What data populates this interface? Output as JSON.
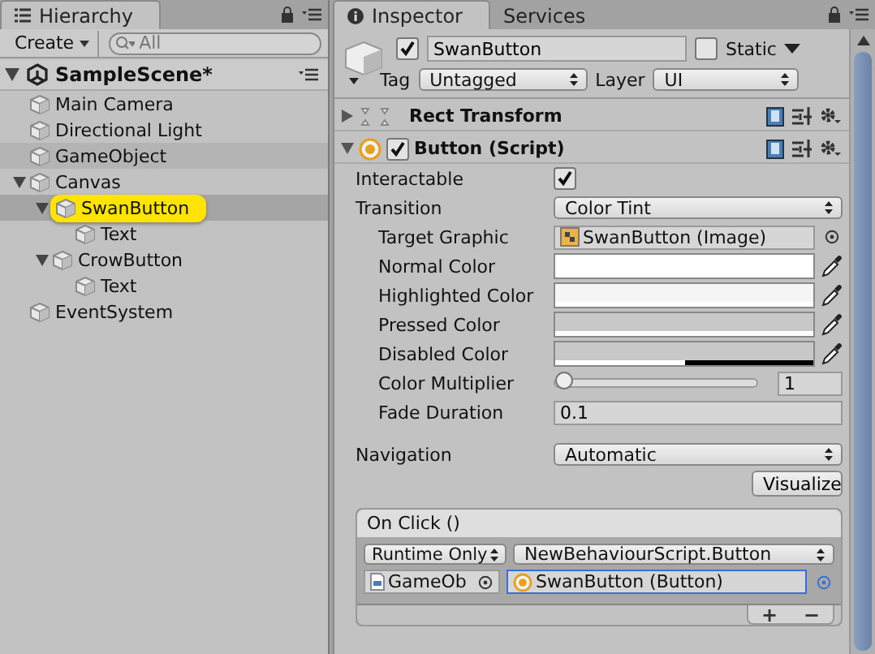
{
  "hierarchy": {
    "tab": "Hierarchy",
    "create": "Create",
    "search": {
      "placeholder": "All"
    },
    "scene": {
      "name": "SampleScene*",
      "expanded": true,
      "children": [
        {
          "name": "Main Camera",
          "selected": false,
          "hovered": false
        },
        {
          "name": "Directional Light",
          "selected": false,
          "hovered": false
        },
        {
          "name": "GameObject",
          "selected": false,
          "hovered": true
        },
        {
          "name": "Canvas",
          "selected": false,
          "hovered": false,
          "expanded": true,
          "children": [
            {
              "name": "SwanButton",
              "selected": true,
              "hovered": false,
              "expanded": true,
              "children": [
                {
                  "name": "Text",
                  "selected": false,
                  "hovered": false
                }
              ]
            },
            {
              "name": "CrowButton",
              "selected": false,
              "hovered": false,
              "expanded": true,
              "children": [
                {
                  "name": "Text",
                  "selected": false,
                  "hovered": false
                }
              ]
            }
          ]
        },
        {
          "name": "EventSystem",
          "selected": false,
          "hovered": false
        }
      ]
    }
  },
  "inspector": {
    "tabs": [
      {
        "label": "Inspector",
        "selected": true
      },
      {
        "label": "Services",
        "selected": false
      }
    ],
    "object": {
      "active": true,
      "name": "SwanButton",
      "static": false,
      "static_label": "Static",
      "tag_label": "Tag",
      "tag": "Untagged",
      "layer_label": "Layer",
      "layer": "UI"
    },
    "components": [
      {
        "kind": "rect",
        "title": "Rect Transform",
        "expanded": false
      },
      {
        "kind": "script",
        "title": "Button (Script)",
        "expanded": true,
        "enabled": true
      }
    ],
    "properties": [
      {
        "kind": "checkbox",
        "label": "Interactable",
        "indent": false,
        "checked": true
      },
      {
        "kind": "dropdown",
        "label": "Transition",
        "indent": false,
        "value": "Color Tint"
      },
      {
        "kind": "object",
        "label": "Target Graphic",
        "indent": true,
        "value": "SwanButton (Image)"
      },
      {
        "kind": "color",
        "label": "Normal Color",
        "indent": true,
        "color": "#ffffff",
        "level": 1
      },
      {
        "kind": "color",
        "label": "Highlighted Color",
        "indent": true,
        "color": "#f5f5f5",
        "level": 1
      },
      {
        "kind": "color",
        "label": "Pressed Color",
        "indent": true,
        "color": "#c8c8c8",
        "level": 1
      },
      {
        "kind": "color",
        "label": "Disabled Color",
        "indent": true,
        "color": "#c8c8c8",
        "level": 0.5
      },
      {
        "kind": "slider",
        "label": "Color Multiplier",
        "indent": true,
        "level": 0,
        "value": "1"
      },
      {
        "kind": "text",
        "label": "Fade Duration",
        "indent": true,
        "value": "0.1"
      },
      {
        "kind": "gap"
      },
      {
        "kind": "dropdown",
        "label": "Navigation",
        "indent": false,
        "value": "Automatic"
      },
      {
        "kind": "button",
        "value": "Visualize"
      }
    ],
    "on_click": {
      "title": "On Click ()",
      "runtime": "Runtime Only",
      "function": "NewBehaviourScript.Button",
      "object": "GameOb",
      "argument": "SwanButton (Button)",
      "add": "+",
      "remove": "−"
    }
  }
}
